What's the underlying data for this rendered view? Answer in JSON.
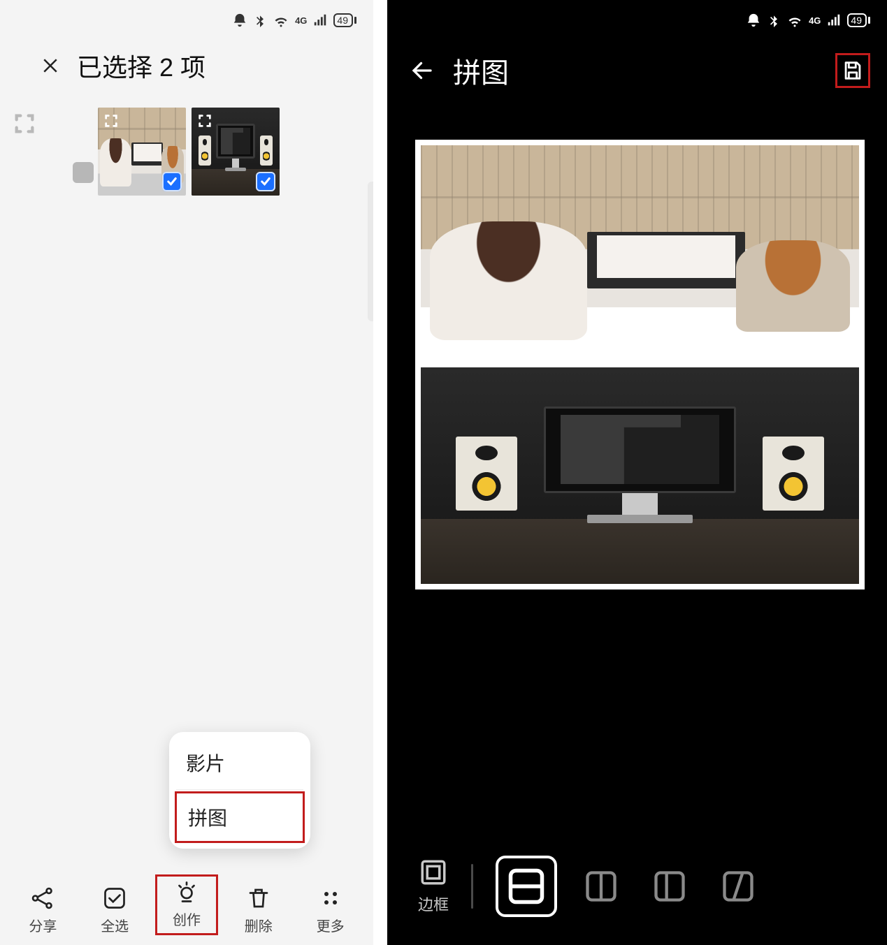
{
  "status": {
    "battery": "49",
    "network_label": "4G"
  },
  "left": {
    "title": "已选择 2 项",
    "popup": {
      "movie": "影片",
      "collage": "拼图"
    },
    "actions": {
      "share": "分享",
      "select_all": "全选",
      "create": "创作",
      "delete": "删除",
      "more": "更多"
    }
  },
  "right": {
    "title": "拼图",
    "frame_label": "边框"
  }
}
